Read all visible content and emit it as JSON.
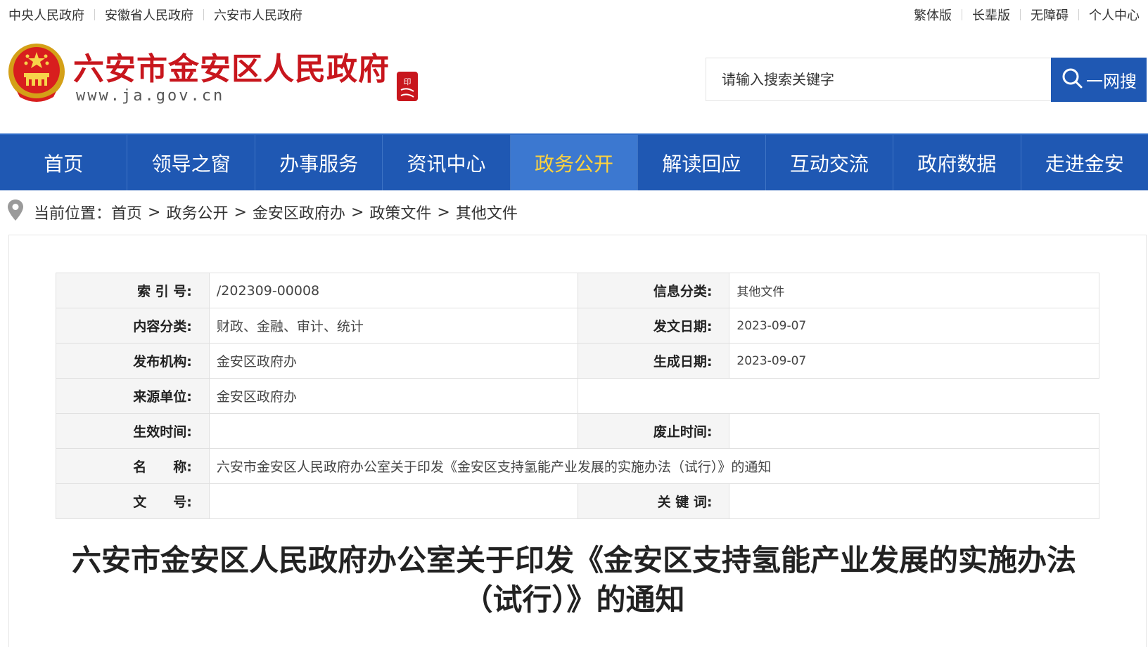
{
  "topbar": {
    "left_links": [
      "中央人民政府",
      "安徽省人民政府",
      "六安市人民政府"
    ],
    "right_links": [
      "繁体版",
      "长辈版",
      "无障碍",
      "个人中心"
    ]
  },
  "header": {
    "site_title": "六安市金安区人民政府",
    "site_url": "www.ja.gov.cn",
    "seal_text": "印"
  },
  "search": {
    "placeholder": "请输入搜索关键字",
    "button_label": "一网搜"
  },
  "nav": {
    "items": [
      "首页",
      "领导之窗",
      "办事服务",
      "资讯中心",
      "政务公开",
      "解读回应",
      "互动交流",
      "政府数据",
      "走进金安"
    ],
    "active": "政务公开"
  },
  "breadcrumb": {
    "prefix": "当前位置：",
    "items": [
      "首页",
      "政务公开",
      "金安区政府办",
      "政策文件",
      "其他文件"
    ],
    "separator": ">"
  },
  "meta": {
    "index_label": "索 引 号:",
    "index_value": "/202309-00008",
    "info_category_label": "信息分类:",
    "info_category_value": "其他文件",
    "content_category_label": "内容分类:",
    "content_category_value": "财政、金融、审计、统计",
    "issue_date_label": "发文日期:",
    "issue_date_value": "2023-09-07",
    "publisher_label": "发布机构:",
    "publisher_value": "金安区政府办",
    "generated_date_label": "生成日期:",
    "generated_date_value": "2023-09-07",
    "source_label": "来源单位:",
    "source_value": "金安区政府办",
    "effective_label": "生效时间:",
    "effective_value": "",
    "expiry_label": "废止时间:",
    "expiry_value": "",
    "name_label": "名　　称:",
    "name_value": "六安市金安区人民政府办公室关于印发《金安区支持氢能产业发展的实施办法（试行）》的通知",
    "doc_no_label": "文　　号:",
    "doc_no_value": "",
    "keywords_label": "关 键 词:",
    "keywords_value": ""
  },
  "document": {
    "title_line1": "六安市金安区人民政府办公室关于印发《金安区支持氢能产业发展的实施办法",
    "title_line2": "（试行）》的通知"
  },
  "colors": {
    "brand_blue": "#1f58b3",
    "active_nav_bg": "#3c78d0",
    "active_nav_text": "#ffd33d",
    "title_red": "#c8161d"
  }
}
